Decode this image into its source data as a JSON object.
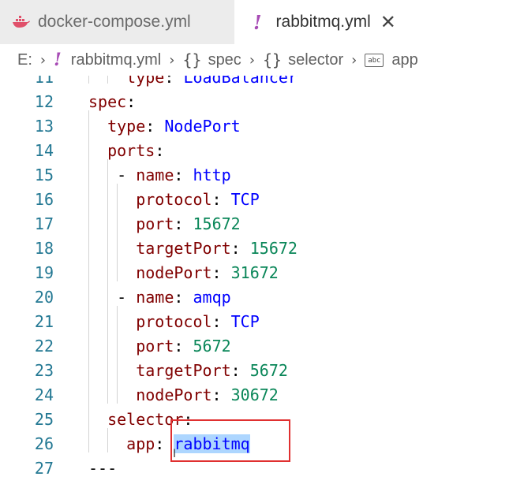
{
  "tabs": [
    {
      "label": "docker-compose.yml",
      "icon": "docker-whale-icon",
      "active": false
    },
    {
      "label": "rabbitmq.yml",
      "icon": "yaml-exclamation-icon",
      "active": true
    }
  ],
  "breadcrumb": {
    "drive": "E:",
    "file": "rabbitmq.yml",
    "spec": "spec",
    "selector": "selector",
    "app": "app"
  },
  "editor": {
    "lines": [
      {
        "n": "11",
        "indent": "    ",
        "key": "type",
        "sep": ": ",
        "value": "LoadBalancer",
        "vtype": "s"
      },
      {
        "n": "12",
        "indent": "",
        "key": "spec",
        "sep": ":",
        "value": "",
        "vtype": "s"
      },
      {
        "n": "13",
        "indent": "  ",
        "key": "type",
        "sep": ": ",
        "value": "NodePort",
        "vtype": "s"
      },
      {
        "n": "14",
        "indent": "  ",
        "key": "ports",
        "sep": ":",
        "value": "",
        "vtype": "s"
      },
      {
        "n": "15",
        "indent": "   - ",
        "key": "name",
        "sep": ": ",
        "value": "http",
        "vtype": "s"
      },
      {
        "n": "16",
        "indent": "     ",
        "key": "protocol",
        "sep": ": ",
        "value": "TCP",
        "vtype": "s"
      },
      {
        "n": "17",
        "indent": "     ",
        "key": "port",
        "sep": ": ",
        "value": "15672",
        "vtype": "n"
      },
      {
        "n": "18",
        "indent": "     ",
        "key": "targetPort",
        "sep": ": ",
        "value": "15672",
        "vtype": "n"
      },
      {
        "n": "19",
        "indent": "     ",
        "key": "nodePort",
        "sep": ": ",
        "value": "31672",
        "vtype": "n"
      },
      {
        "n": "20",
        "indent": "   - ",
        "key": "name",
        "sep": ": ",
        "value": "amqp",
        "vtype": "s"
      },
      {
        "n": "21",
        "indent": "     ",
        "key": "protocol",
        "sep": ": ",
        "value": "TCP",
        "vtype": "s"
      },
      {
        "n": "22",
        "indent": "     ",
        "key": "port",
        "sep": ": ",
        "value": "5672",
        "vtype": "n"
      },
      {
        "n": "23",
        "indent": "     ",
        "key": "targetPort",
        "sep": ": ",
        "value": "5672",
        "vtype": "n"
      },
      {
        "n": "24",
        "indent": "     ",
        "key": "nodePort",
        "sep": ": ",
        "value": "30672",
        "vtype": "n"
      },
      {
        "n": "25",
        "indent": "  ",
        "key": "selector",
        "sep": ":",
        "value": "",
        "vtype": "s"
      },
      {
        "n": "26",
        "indent": "    ",
        "key": "app",
        "sep": ": ",
        "value": "rabbitmq",
        "vtype": "s",
        "selected": true
      },
      {
        "n": "27",
        "indent": "",
        "key": "",
        "sep": "---",
        "value": "",
        "vtype": "s"
      }
    ]
  },
  "colors": {
    "key": "#800000",
    "string": "#0000ff",
    "number": "#098658",
    "line_number": "#237893",
    "highlight_box": "#e03030",
    "selection": "#add6ff"
  }
}
